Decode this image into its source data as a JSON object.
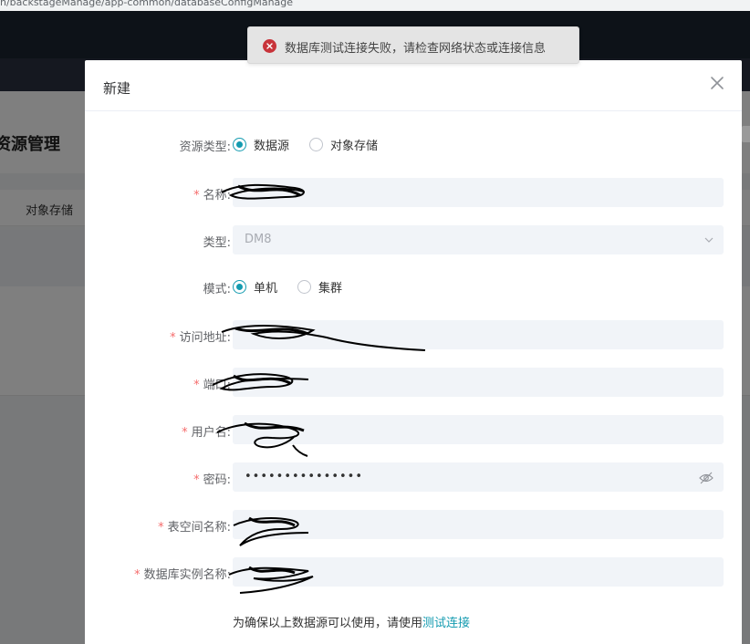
{
  "browser": {
    "url": "n/backstageManage/app-common/databaseConfigManage"
  },
  "background": {
    "page_title": "资源管理",
    "tab_object_storage": "对象存储"
  },
  "toast": {
    "message": "数据库测试连接失败，请检查网络状态或连接信息",
    "icon": "error-circle-icon",
    "color": "#c8333a"
  },
  "dialog": {
    "title": "新建",
    "close_icon": "close-icon",
    "resource_type": {
      "label": "资源类型:",
      "options": [
        "数据源",
        "对象存储"
      ],
      "selected": "数据源"
    },
    "name": {
      "label": "名称:",
      "required": "*",
      "value": ""
    },
    "db_type": {
      "label": "类型:",
      "value": "DM8"
    },
    "mode": {
      "label": "模式:",
      "options": [
        "单机",
        "集群"
      ],
      "selected": "单机"
    },
    "address": {
      "label": "访问地址:",
      "required": "*",
      "value": ""
    },
    "port": {
      "label": "端口:",
      "required": "*",
      "value": ""
    },
    "username": {
      "label": "用户名:",
      "required": "*",
      "value": ""
    },
    "password": {
      "label": "密码:",
      "required": "*",
      "value": "•••••••••••••••"
    },
    "tablespace": {
      "label": "表空间名称:",
      "required": "*",
      "value": ""
    },
    "instance": {
      "label": "数据库实例名称:",
      "required": "*",
      "value": ""
    },
    "footnote": {
      "text": "为确保以上数据源可以使用，请使用",
      "link": "测试连接"
    },
    "accent_color": "#149bb0"
  }
}
